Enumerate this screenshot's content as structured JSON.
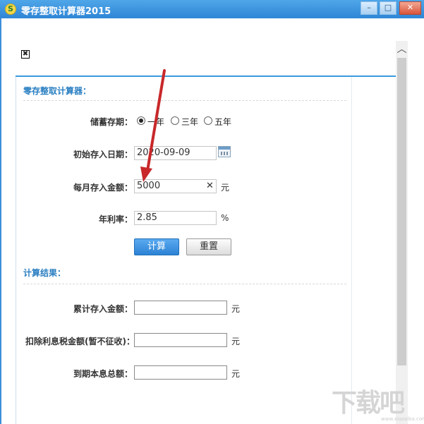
{
  "window": {
    "title": "零存整取计算器2015",
    "app_icon": "S",
    "minimize": "–",
    "maximize": "□",
    "close": "✕"
  },
  "broken_image": "✖",
  "form": {
    "section_title": "零存整取计算器：",
    "term_label": "储蓄存期：",
    "term_options": [
      "一年",
      "三年",
      "五年"
    ],
    "term_selected": "一年",
    "start_date_label": "初始存入日期：",
    "start_date_value": "2020-09-09",
    "monthly_label": "每月存入金额：",
    "monthly_value": "5000",
    "monthly_clear": "✕",
    "monthly_unit": "元",
    "rate_label": "年利率：",
    "rate_value": "2.85",
    "rate_unit": "%",
    "calc_button": "计算",
    "reset_button": "重置"
  },
  "results": {
    "section_title": "计算结果：",
    "rows": [
      {
        "label": "累计存入金额：",
        "value": "",
        "unit": "元"
      },
      {
        "label": "扣除利息税金额(暂不征收)：",
        "value": "",
        "unit": "元"
      },
      {
        "label": "到期本息总额：",
        "value": "",
        "unit": "元"
      }
    ]
  },
  "scrollbar": {
    "up_arrow": "︿"
  },
  "watermark": {
    "main": "下载吧",
    "sub": "www.xiazaiba.com"
  },
  "colors": {
    "accent": "#2f86d6",
    "section_title": "#2a7fc2",
    "arrow": "#c8282a"
  }
}
